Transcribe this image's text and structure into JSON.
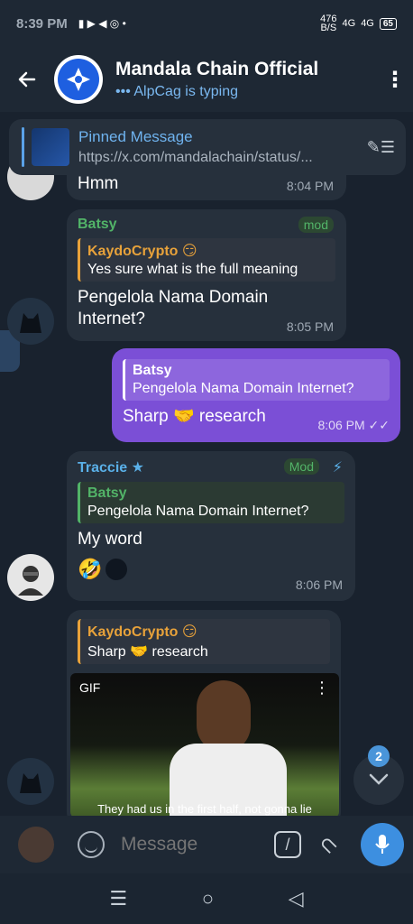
{
  "status": {
    "time": "8:39 PM",
    "speed": "476",
    "speed_unit": "B/S",
    "net1": "4G",
    "net2": "4G",
    "battery": "65"
  },
  "header": {
    "title": "Mandala Chain Official",
    "subtitle": "AlpCag is typing"
  },
  "pinned": {
    "title": "Pinned Message",
    "text": "https://x.com/mandalachain/status/..."
  },
  "messages": [
    {
      "text": "Hmm",
      "time": "8:04 PM"
    },
    {
      "sender": "Batsy",
      "badge": "mod",
      "reply_name": "KaydoCrypto 😏",
      "reply_text": "Yes sure what is the full meaning",
      "text": "Pengelola Nama Domain Internet?",
      "time": "8:05 PM"
    },
    {
      "reply_name": "Batsy",
      "reply_text": "Pengelola Nama Domain Internet?",
      "text": "Sharp 🤝 research",
      "time": "8:06 PM"
    },
    {
      "sender": "Traccie",
      "badge": "Mod",
      "reply_name": "Batsy",
      "reply_text": "Pengelola Nama Domain Internet?",
      "text": "My word",
      "reaction": "🤣",
      "time": "8:06 PM"
    },
    {
      "reply_name": "KaydoCrypto 😏",
      "reply_text": "Sharp 🤝 research",
      "gif_label": "GIF",
      "gif_caption": "They had us in the first half, not gonna lie"
    }
  ],
  "scroll_badge": "2",
  "composer": {
    "placeholder": "Message"
  }
}
